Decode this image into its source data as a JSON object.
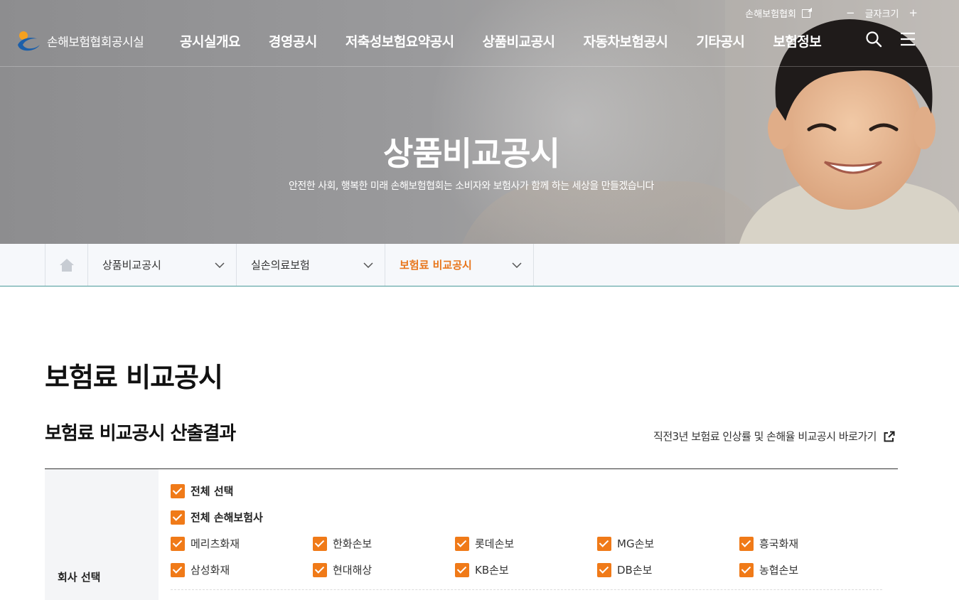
{
  "utility": {
    "association_link": "손해보험협회",
    "font_size_label": "글자크기",
    "minus": "−",
    "plus": "+"
  },
  "header": {
    "logo_text": "손해보험협회공시실",
    "nav": [
      "공시실개요",
      "경영공시",
      "저축성보험요약공시",
      "상품비교공시",
      "자동차보험공시",
      "기타공시",
      "보험정보"
    ]
  },
  "hero": {
    "title": "상품비교공시",
    "subtitle": "안전한 사회, 행복한 미래 손해보험협회는 소비자와 보험사가 함께 하는 세상을 만들겠습니다"
  },
  "breadcrumb": {
    "items": [
      "상품비교공시",
      "실손의료보험",
      "보험료 비교공시"
    ],
    "active_index": 2
  },
  "page": {
    "title": "보험료 비교공시",
    "section_title": "보험료 비교공시 산출결과",
    "shortcut_link": "직전3년 보험료 인상률 및 손해율 비교공시 바로가기"
  },
  "filter": {
    "label": "회사 선택",
    "select_all": "전체 선택",
    "select_all_nonlife": "전체 손해보험사",
    "companies": [
      [
        "메리츠화재",
        "한화손보",
        "롯데손보",
        "MG손보",
        "흥국화재"
      ],
      [
        "삼성화재",
        "현대해상",
        "KB손보",
        "DB손보",
        "농협손보"
      ]
    ]
  },
  "colors": {
    "accent": "#f07a18",
    "active_breadcrumb": "#e8761c",
    "breadcrumb_line": "#4b9b9a"
  }
}
